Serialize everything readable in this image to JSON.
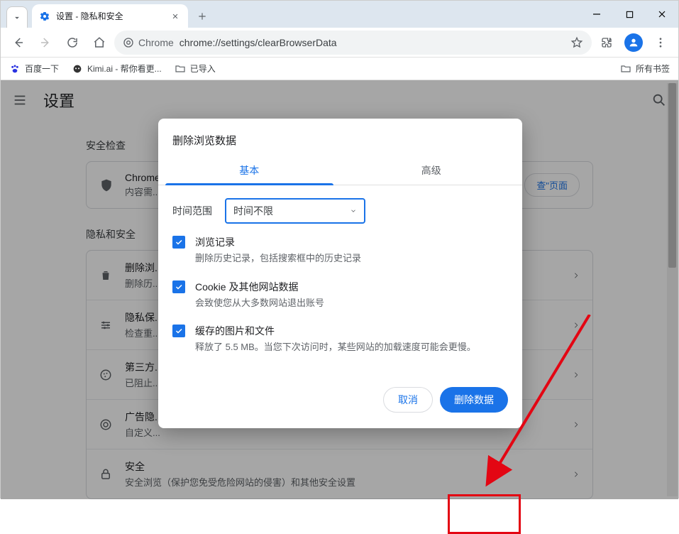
{
  "titlebar": {
    "tab_title": "设置 - 隐私和安全"
  },
  "toolbar": {
    "chrome_label": "Chrome",
    "url": "chrome://settings/clearBrowserData"
  },
  "bookmarks": {
    "b1": "百度一下",
    "b2": "Kimi.ai - 帮你看更...",
    "b3": "已导入",
    "all": "所有书签"
  },
  "page": {
    "settings_title": "设置",
    "sec1_label": "安全检查",
    "safety_t1": "Chrome",
    "safety_t2": "内容需...",
    "safety_btn": "查\"页面",
    "sec2_label": "隐私和安全",
    "rows": [
      {
        "t1": "删除浏...",
        "t2": "删除历..."
      },
      {
        "t1": "隐私保...",
        "t2": "检查重..."
      },
      {
        "t1": "第三方...",
        "t2": "已阻止..."
      },
      {
        "t1": "广告隐...",
        "t2": "自定义..."
      },
      {
        "t1": "安全",
        "t2": "安全浏览（保护您免受危险网站的侵害）和其他安全设置"
      }
    ]
  },
  "dialog": {
    "title": "删除浏览数据",
    "tab_basic": "基本",
    "tab_advanced": "高级",
    "range_label": "时间范围",
    "range_value": "时间不限",
    "items": [
      {
        "c1": "浏览记录",
        "c2": "删除历史记录，包括搜索框中的历史记录"
      },
      {
        "c1": "Cookie 及其他网站数据",
        "c2": "会致使您从大多数网站退出账号"
      },
      {
        "c1": "缓存的图片和文件",
        "c2": "释放了 5.5 MB。当您下次访问时，某些网站的加载速度可能会更慢。"
      }
    ],
    "cancel": "取消",
    "confirm": "删除数据"
  }
}
